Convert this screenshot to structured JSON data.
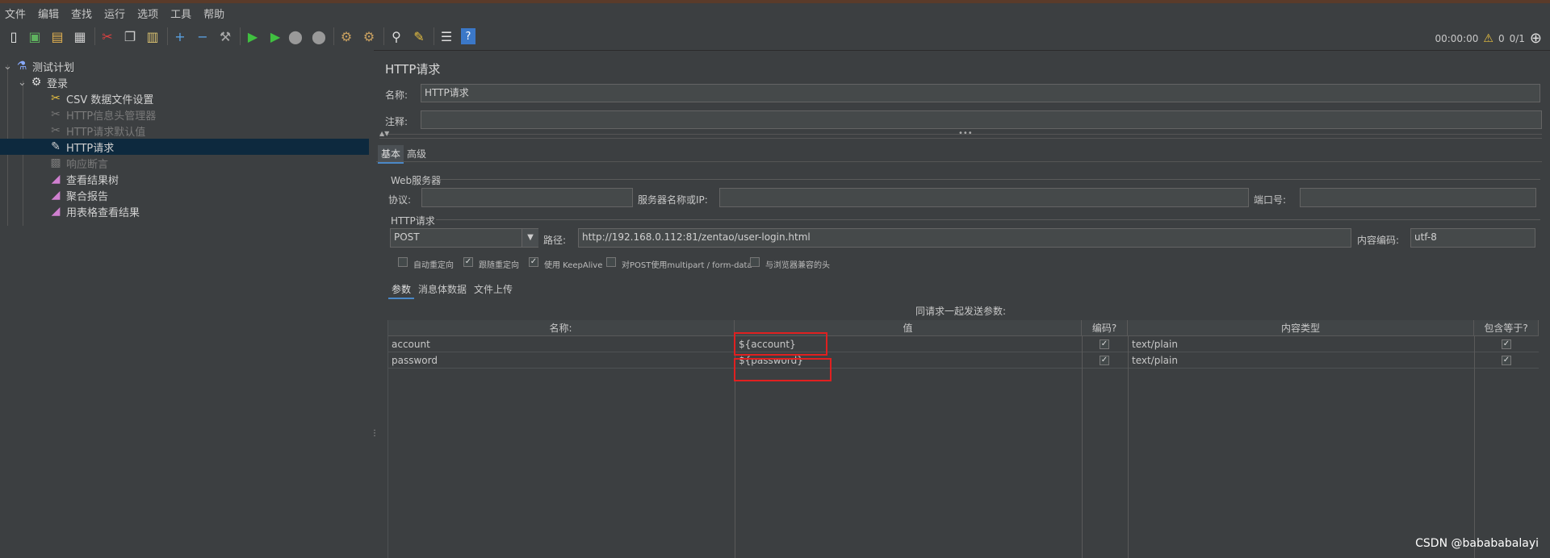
{
  "menu": [
    "文件",
    "编辑",
    "查找",
    "运行",
    "选项",
    "工具",
    "帮助"
  ],
  "status": {
    "time": "00:00:00",
    "warnings": "0",
    "threads": "0/1"
  },
  "tree": [
    {
      "label": "测试计划",
      "icon": "flask-icon",
      "dim": false
    },
    {
      "label": "登录",
      "icon": "gear-icon",
      "dim": false
    },
    {
      "label": "CSV 数据文件设置",
      "icon": "scissors-icon",
      "dim": false
    },
    {
      "label": "HTTP信息头管理器",
      "icon": "scissors-icon",
      "dim": true
    },
    {
      "label": "HTTP请求默认值",
      "icon": "scissors-icon",
      "dim": true
    },
    {
      "label": "HTTP请求",
      "icon": "pen-icon",
      "dim": false
    },
    {
      "label": "响应断言",
      "icon": "assert-icon",
      "dim": true
    },
    {
      "label": "查看结果树",
      "icon": "chart-icon",
      "dim": false
    },
    {
      "label": "聚合报告",
      "icon": "chart-icon",
      "dim": false
    },
    {
      "label": "用表格查看结果",
      "icon": "chart-icon",
      "dim": false
    }
  ],
  "panel": {
    "title": "HTTP请求",
    "name_label": "名称:",
    "name_value": "HTTP请求",
    "comment_label": "注释:",
    "comment_value": "",
    "tabs": [
      "基本",
      "高级"
    ],
    "web_server_label": "Web服务器",
    "protocol_label": "协议:",
    "server_label": "服务器名称或IP:",
    "port_label": "端口号:",
    "http_request_label": "HTTP请求",
    "method": "POST",
    "path_label": "路径:",
    "path_value": "http://192.168.0.112:81/zentao/user-login.html",
    "encoding_label": "内容编码:",
    "encoding_value": "utf-8",
    "options": [
      {
        "label": "自动重定向",
        "checked": false
      },
      {
        "label": "跟随重定向",
        "checked": true
      },
      {
        "label": "使用 KeepAlive",
        "checked": true
      },
      {
        "label": "对POST使用multipart / form-data",
        "checked": false
      },
      {
        "label": "与浏览器兼容的头",
        "checked": false
      }
    ],
    "subtabs": [
      "参数",
      "消息体数据",
      "文件上传"
    ],
    "params_caption": "同请求一起发送参数:",
    "columns": [
      "名称:",
      "值",
      "编码?",
      "内容类型",
      "包含等于?"
    ],
    "rows": [
      {
        "name": "account",
        "value": "${account}",
        "encode": true,
        "content_type": "text/plain",
        "include_equals": true
      },
      {
        "name": "password",
        "value": "${password}",
        "encode": true,
        "content_type": "text/plain",
        "include_equals": true
      }
    ]
  },
  "watermark": "CSDN @babababalayi"
}
